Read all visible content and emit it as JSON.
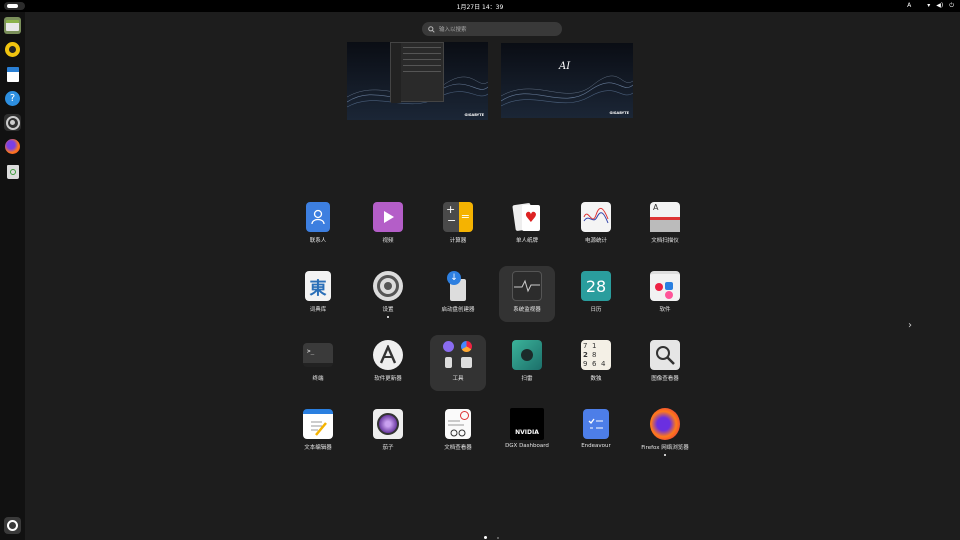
{
  "topbar": {
    "clock": "1月27日 14：39",
    "input_indicator": "A",
    "icons": [
      "network-icon",
      "volume-icon",
      "power-icon"
    ]
  },
  "dock": {
    "items": [
      "files-icon",
      "rhythmbox-icon",
      "writer-icon",
      "help-icon",
      "settings-icon",
      "firefox-icon",
      "trash-icon",
      "show-apps-icon"
    ]
  },
  "search": {
    "placeholder": "输入以搜索"
  },
  "workspaces": [
    {
      "brand": "GIGABYTE"
    },
    {
      "brand": "GIGABYTE",
      "logo": "AI"
    }
  ],
  "apps": [
    {
      "label": "联系人",
      "icon": "contacts-icon"
    },
    {
      "label": "视频",
      "icon": "videos-icon"
    },
    {
      "label": "计算器",
      "icon": "calculator-icon"
    },
    {
      "label": "单人纸牌",
      "icon": "solitaire-icon"
    },
    {
      "label": "电源统计",
      "icon": "power-statistics-icon"
    },
    {
      "label": "文档扫描仪",
      "icon": "document-scanner-icon"
    },
    {
      "label": "词典库",
      "icon": "dictionary-icon"
    },
    {
      "label": "设置",
      "icon": "settings-icon"
    },
    {
      "label": "启动盘创建器",
      "icon": "startup-disk-creator-icon"
    },
    {
      "label": "系统监视器",
      "icon": "system-monitor-icon"
    },
    {
      "label": "日历",
      "icon": "calendar-icon",
      "glyph": "28"
    },
    {
      "label": "软件",
      "icon": "software-icon"
    },
    {
      "label": "终端",
      "icon": "terminal-icon",
      "glyph": ">_"
    },
    {
      "label": "软件更新器",
      "icon": "software-updater-icon"
    },
    {
      "label": "工具",
      "icon": "utilities-folder-icon"
    },
    {
      "label": "扫雷",
      "icon": "mines-icon"
    },
    {
      "label": "数独",
      "icon": "sudoku-icon"
    },
    {
      "label": "图像查看器",
      "icon": "image-viewer-icon"
    },
    {
      "label": "文本编辑器",
      "icon": "text-editor-icon"
    },
    {
      "label": "茄子",
      "icon": "cheese-icon"
    },
    {
      "label": "文档查看器",
      "icon": "document-viewer-icon"
    },
    {
      "label": "DGX Dashboard",
      "icon": "nvidia-icon",
      "glyph": "NVIDIA"
    },
    {
      "label": "Endeavour",
      "icon": "endeavour-icon"
    },
    {
      "label": "Firefox 网络浏览器",
      "icon": "firefox-icon"
    }
  ],
  "colors": {
    "background": "#1d1d1d",
    "topbar": "#000000",
    "dock": "#111111",
    "selected_tile": "#333333"
  }
}
